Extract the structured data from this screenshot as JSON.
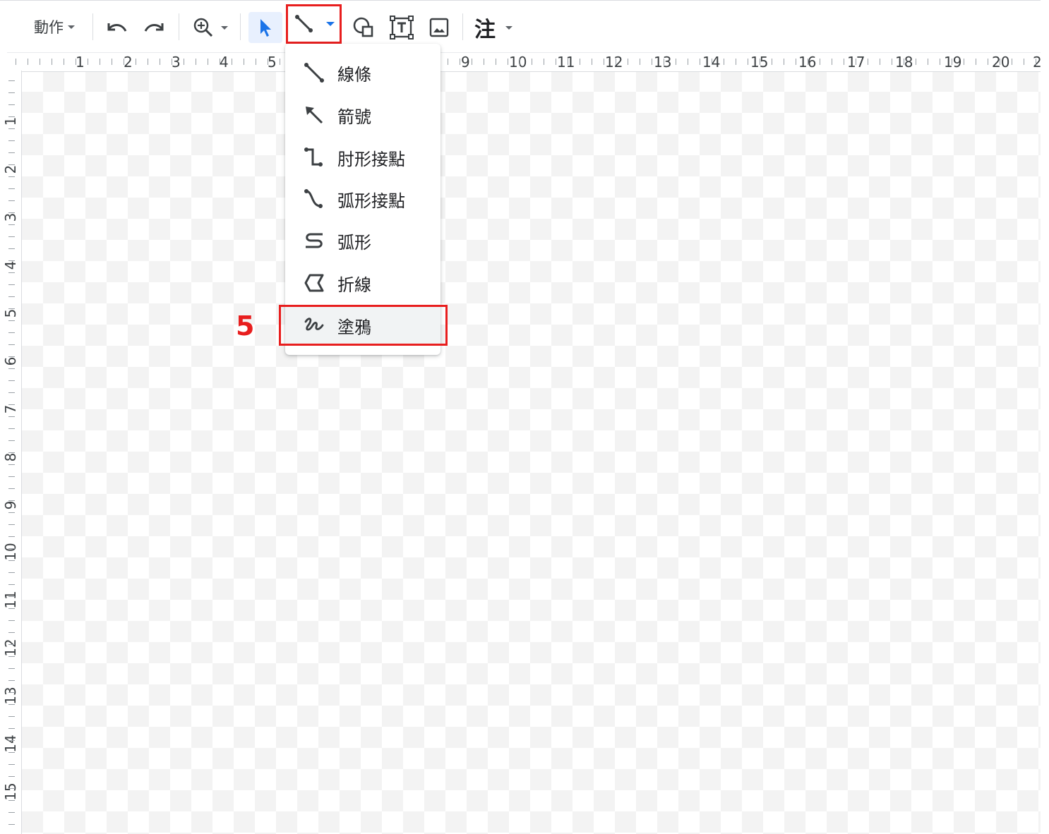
{
  "toolbar": {
    "actions_label": "動作",
    "annotation_label": "注",
    "icons": {
      "undo": "undo-icon",
      "redo": "redo-icon",
      "zoom": "zoom-in-icon",
      "select": "pointer-arrow-icon",
      "line": "line-icon",
      "shape": "shape-icon",
      "textbox": "text-box-icon",
      "image": "image-icon"
    }
  },
  "ruler": {
    "horizontal": [
      "1",
      "2",
      "3",
      "4",
      "5",
      "9",
      "10",
      "11",
      "12",
      "13",
      "14",
      "15",
      "16",
      "17",
      "18",
      "19",
      "20",
      "2"
    ],
    "vertical": [
      "1",
      "2",
      "3",
      "4",
      "5",
      "6",
      "7",
      "8",
      "9",
      "10",
      "11",
      "12",
      "13",
      "14",
      "15"
    ]
  },
  "line_menu": {
    "items": [
      {
        "label": "線條",
        "icon": "line-icon"
      },
      {
        "label": "箭號",
        "icon": "arrow-icon"
      },
      {
        "label": "肘形接點",
        "icon": "elbow-connector-icon"
      },
      {
        "label": "弧形接點",
        "icon": "curved-connector-icon"
      },
      {
        "label": "弧形",
        "icon": "curve-icon"
      },
      {
        "label": "折線",
        "icon": "polyline-icon"
      },
      {
        "label": "塗鴉",
        "icon": "scribble-icon"
      }
    ],
    "selected_index": 6
  },
  "annotation": {
    "step_number": "5",
    "highlight_color": "#e81e1e"
  },
  "colors": {
    "accent": "#1a73e8",
    "highlight": "#e81e1e",
    "select_bg": "#e8f0fe"
  }
}
